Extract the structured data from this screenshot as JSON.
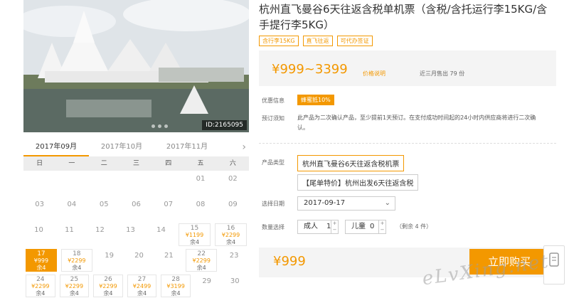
{
  "photo": {
    "id_label": "ID:2165095"
  },
  "calendar": {
    "tabs": [
      "2017年09月",
      "2017年10月",
      "2017年11月"
    ],
    "next_icon": "chevron-right-icon",
    "weekdays": [
      "日",
      "一",
      "二",
      "三",
      "四",
      "五",
      "六"
    ],
    "rows": [
      [
        {
          "day": ""
        },
        {
          "day": ""
        },
        {
          "day": ""
        },
        {
          "day": ""
        },
        {
          "day": ""
        },
        {
          "day": "01"
        },
        {
          "day": "02"
        }
      ],
      [
        {
          "day": "03"
        },
        {
          "day": "04"
        },
        {
          "day": "05"
        },
        {
          "day": "06"
        },
        {
          "day": "07"
        },
        {
          "day": "08"
        },
        {
          "day": "09"
        }
      ],
      [
        {
          "day": "10"
        },
        {
          "day": "11"
        },
        {
          "day": "12"
        },
        {
          "day": "13"
        },
        {
          "day": "14"
        },
        {
          "day": "15",
          "price": "¥1199",
          "remain": "余4"
        },
        {
          "day": "16",
          "price": "¥2299",
          "remain": "余4"
        }
      ],
      [
        {
          "day": "17",
          "price": "¥999",
          "remain": "余4",
          "selected": true
        },
        {
          "day": "18",
          "price": "¥2299",
          "remain": "余4"
        },
        {
          "day": "19"
        },
        {
          "day": "20"
        },
        {
          "day": "21"
        },
        {
          "day": "22",
          "price": "¥2299",
          "remain": "余4"
        },
        {
          "day": "23"
        }
      ],
      [
        {
          "day": "24",
          "price": "¥2299",
          "remain": "余4"
        },
        {
          "day": "25",
          "price": "¥2299",
          "remain": "余4"
        },
        {
          "day": "26",
          "price": "¥2299",
          "remain": "余4"
        },
        {
          "day": "27",
          "price": "¥2499",
          "remain": "余4"
        },
        {
          "day": "28",
          "price": "¥3199",
          "remain": "余4"
        },
        {
          "day": "29"
        },
        {
          "day": "30"
        }
      ]
    ]
  },
  "product": {
    "title": "杭州直飞曼谷6天往返含税单机票（含税/含托运行李15KG/含手提行李5KG）",
    "tags": [
      "含行李15KG",
      "直飞往返",
      "可代办签证"
    ],
    "price_range": "¥999~3399",
    "price_note": "价格说明",
    "sold": "近三月售出 79 份"
  },
  "info": {
    "promo_label": "优惠信息",
    "promo_badge": "蜂蜜抵10%",
    "notice_label": "预订须知",
    "notice_text": "此产品为二次确认产品，至少提前1天预订。在支付成功时间起的24小时内供应商将进行二次确认。",
    "type_label": "产品类型",
    "type_options": [
      "杭州直飞曼谷6天往返含税机票",
      "【尾单特价】杭州出发6天往返含税"
    ],
    "date_label": "选择日期",
    "date_value": "2017-09-17",
    "qty_label": "数量选择",
    "adult_label": "成人",
    "adult_value": "1",
    "child_label": "儿童",
    "child_value": "0",
    "remain_text": "（剩余 4 件）"
  },
  "checkout": {
    "price": "¥999",
    "buy_label": "立即购买"
  },
  "side": {
    "icon": "edit-icon",
    "label": ""
  },
  "watermark": "eLvXing.net",
  "colors": {
    "accent": "#f39800"
  }
}
